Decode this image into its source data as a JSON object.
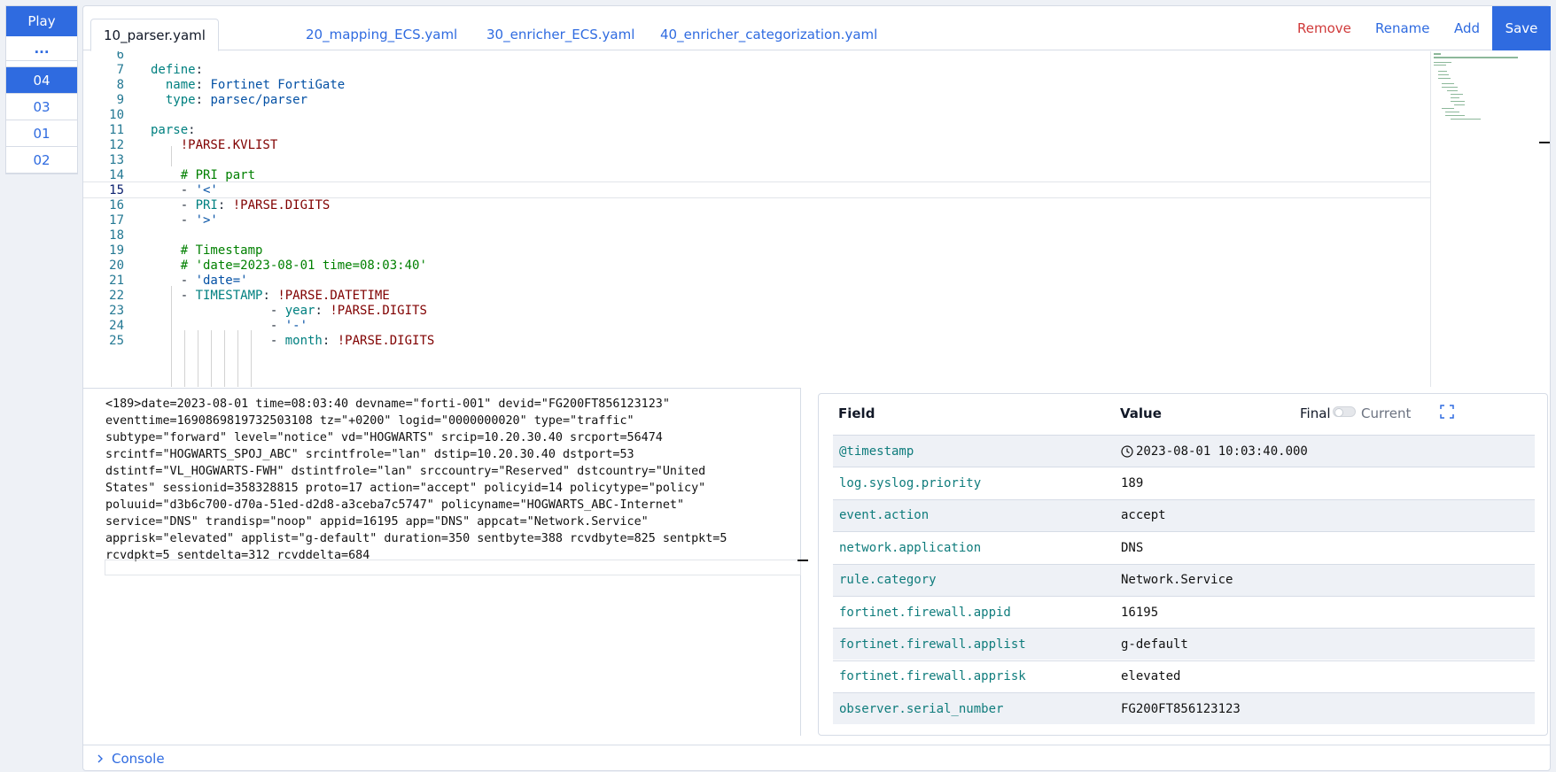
{
  "sidebar": {
    "play_label": "Play",
    "more_label": "...",
    "samples": [
      "04",
      "03",
      "01",
      "02"
    ],
    "active_sample": "04"
  },
  "tabs": [
    {
      "label": "10_parser.yaml",
      "active": true
    },
    {
      "label": "20_mapping_ECS.yaml",
      "active": false
    },
    {
      "label": "30_enricher_ECS.yaml",
      "active": false
    },
    {
      "label": "40_enricher_categorization.yaml",
      "active": false
    }
  ],
  "actions": {
    "remove": "Remove",
    "rename": "Rename",
    "add": "Add",
    "save": "Save"
  },
  "editor": {
    "current_line": 15,
    "lines": [
      {
        "n": "6",
        "code": ""
      },
      {
        "n": "7",
        "code": "define:"
      },
      {
        "n": "8",
        "code": "  name: Fortinet FortiGate"
      },
      {
        "n": "9",
        "code": "  type: parsec/parser"
      },
      {
        "n": "10",
        "code": ""
      },
      {
        "n": "11",
        "code": "parse:"
      },
      {
        "n": "12",
        "code": "    !PARSE.KVLIST"
      },
      {
        "n": "13",
        "code": ""
      },
      {
        "n": "14",
        "code": "    # PRI part"
      },
      {
        "n": "15",
        "code": "    - '<'"
      },
      {
        "n": "16",
        "code": "    - PRI: !PARSE.DIGITS"
      },
      {
        "n": "17",
        "code": "    - '>'"
      },
      {
        "n": "18",
        "code": ""
      },
      {
        "n": "19",
        "code": "    # Timestamp"
      },
      {
        "n": "20",
        "code": "    # 'date=2023-08-01 time=08:03:40'"
      },
      {
        "n": "21",
        "code": "    - 'date='"
      },
      {
        "n": "22",
        "code": "    - TIMESTAMP: !PARSE.DATETIME"
      },
      {
        "n": "23",
        "code": "                - year: !PARSE.DIGITS"
      },
      {
        "n": "24",
        "code": "                - '-'"
      },
      {
        "n": "25",
        "code": "                - month: !PARSE.DIGITS"
      }
    ]
  },
  "log_text": "<189>date=2023-08-01 time=08:03:40 devname=\"forti-001\" devid=\"FG200FT856123123\"\neventtime=1690869819732503108 tz=\"+0200\" logid=\"0000000020\" type=\"traffic\"\nsubtype=\"forward\" level=\"notice\" vd=\"HOGWARTS\" srcip=10.20.30.40 srcport=56474\nsrcintf=\"HOGWARTS_SPOJ_ABC\" srcintfrole=\"lan\" dstip=10.20.30.40 dstport=53\ndstintf=\"VL_HOGWARTS-FWH\" dstintfrole=\"lan\" srccountry=\"Reserved\" dstcountry=\"United\nStates\" sessionid=358328815 proto=17 action=\"accept\" policyid=14 policytype=\"policy\"\npoluuid=\"d3b6c700-d70a-51ed-d2d8-a3ceba7c5747\" policyname=\"HOGWARTS_ABC-Internet\"\nservice=\"DNS\" trandisp=\"noop\" appid=16195 app=\"DNS\" appcat=\"Network.Service\"\napprisk=\"elevated\" applist=\"g-default\" duration=350 sentbyte=388 rcvdbyte=825 sentpkt=5\nrcvdpkt=5 sentdelta=312 rcvddelta=684",
  "fields": {
    "header_field": "Field",
    "header_value": "Value",
    "final_label": "Final",
    "current_label": "Current",
    "rows": [
      {
        "name": "@timestamp",
        "value": "2023-08-01 10:03:40.000",
        "icon": "clock-icon"
      },
      {
        "name": "log.syslog.priority",
        "value": "189"
      },
      {
        "name": "event.action",
        "value": "accept"
      },
      {
        "name": "network.application",
        "value": "DNS"
      },
      {
        "name": "rule.category",
        "value": "Network.Service"
      },
      {
        "name": "fortinet.firewall.appid",
        "value": "16195"
      },
      {
        "name": "fortinet.firewall.applist",
        "value": "g-default"
      },
      {
        "name": "fortinet.firewall.apprisk",
        "value": "elevated"
      },
      {
        "name": "observer.serial_number",
        "value": "FG200FT856123123"
      }
    ]
  },
  "console_label": "Console",
  "colors": {
    "accent": "#2f6be0",
    "danger": "#d03a3a",
    "key": "#008080",
    "tag": "#800000",
    "comment": "#008000",
    "string": "#0451a5"
  }
}
